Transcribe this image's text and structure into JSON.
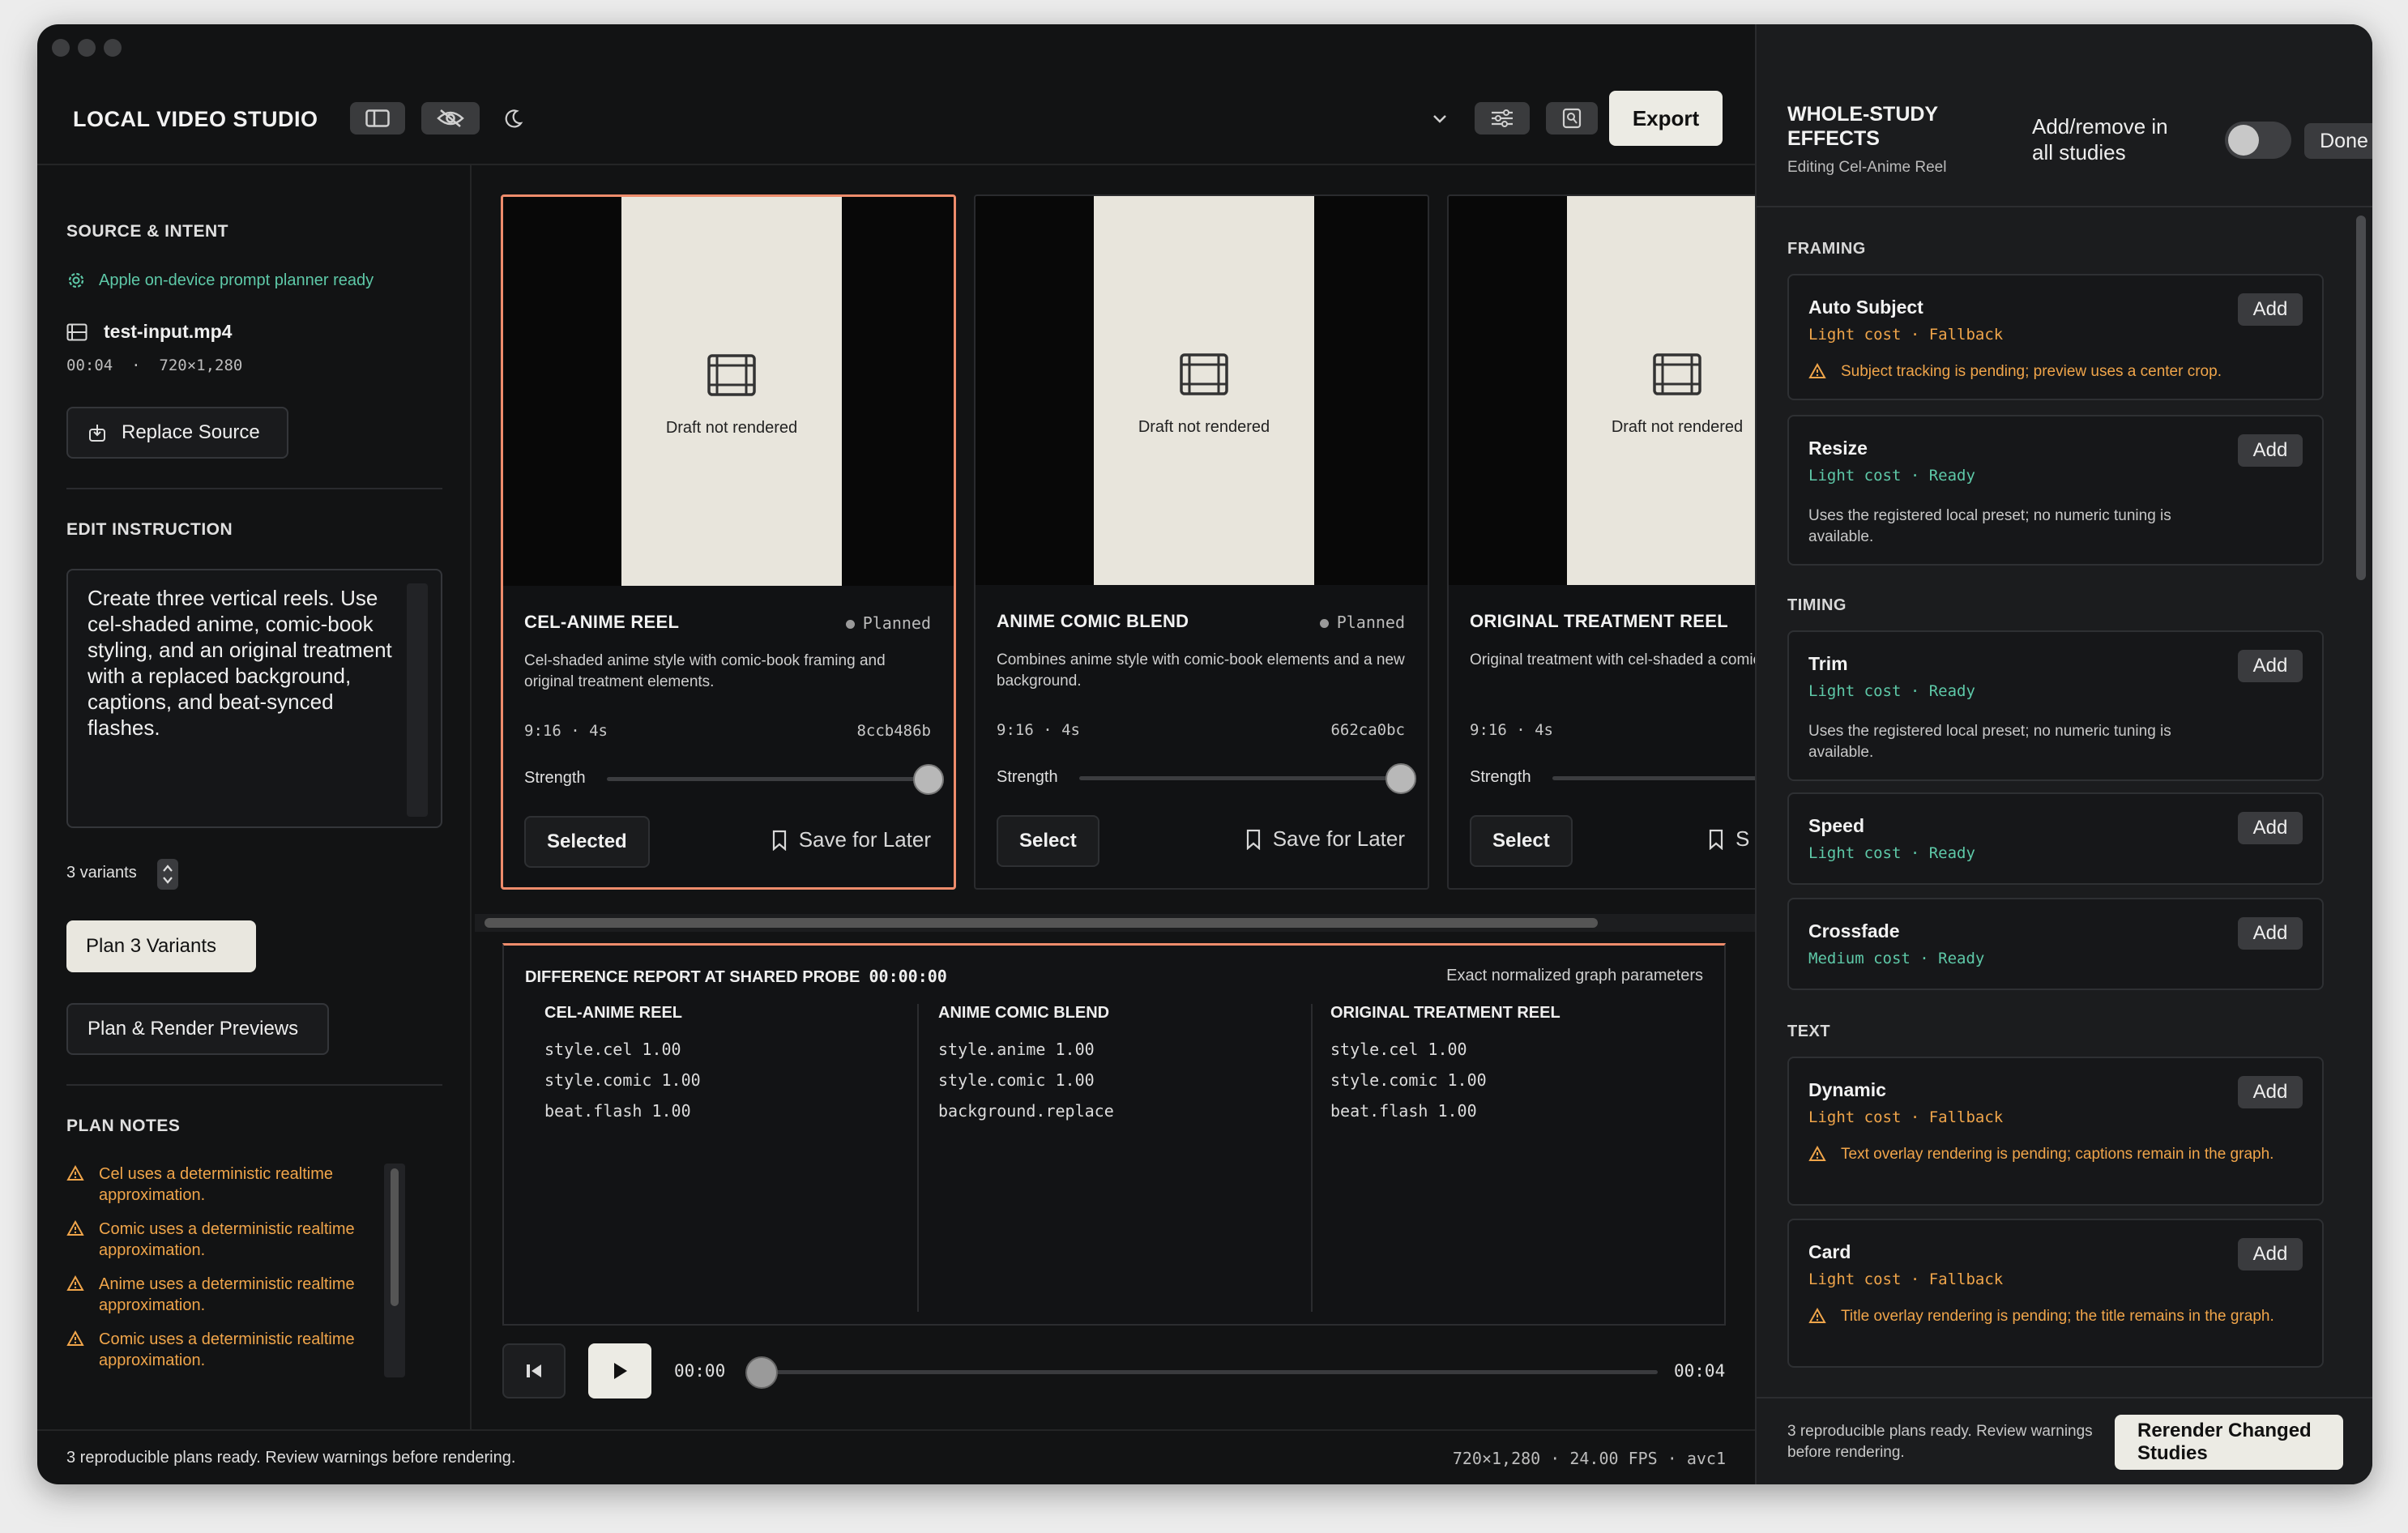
{
  "app": {
    "title": "LOCAL VIDEO STUDIO",
    "export_label": "Export"
  },
  "left": {
    "source_heading": "SOURCE & INTENT",
    "planner_status": "Apple on-device prompt planner ready",
    "file_name": "test-input.mp4",
    "file_meta": "00:04  ·  720×1,280",
    "replace_label": "Replace Source",
    "edit_heading": "EDIT INSTRUCTION",
    "instruction": "Create three vertical reels. Use cel-shaded anime, comic-book styling, and an original treatment with a replaced background, captions, and beat-synced flashes.",
    "variants_label": "3 variants",
    "plan_label": "Plan 3 Variants",
    "plan_render_label": "Plan & Render Previews",
    "notes_heading": "PLAN NOTES",
    "notes": [
      "Cel uses a deterministic realtime approximation.",
      "Comic uses a deterministic realtime approximation.",
      "Anime uses a deterministic realtime approximation.",
      "Comic uses a deterministic realtime approximation."
    ]
  },
  "cards": [
    {
      "title": "CEL-ANIME REEL",
      "status": "Planned",
      "desc": "Cel-shaded anime style with comic-book framing and original treatment elements.",
      "meta": "9:16 · 4s",
      "hash": "8ccb486b",
      "strength_label": "Strength",
      "strength": 1.0,
      "button": "Selected",
      "save": "Save for Later",
      "placeholder": "Draft not rendered"
    },
    {
      "title": "ANIME COMIC BLEND",
      "status": "Planned",
      "desc": "Combines anime style with comic-book elements and a new background.",
      "meta": "9:16 · 4s",
      "hash": "662ca0bc",
      "strength_label": "Strength",
      "strength": 1.0,
      "button": "Select",
      "save": "Save for Later",
      "placeholder": "Draft not rendered"
    },
    {
      "title": "ORIGINAL TREATMENT REEL",
      "status": "",
      "desc": "Original treatment with cel-shaded a comic-book styling.",
      "meta": "9:16 · 4s",
      "hash": "",
      "strength_label": "Strength",
      "strength": 1.0,
      "button": "Select",
      "save": "S",
      "placeholder": "Draft not rendered"
    }
  ],
  "diff": {
    "heading": "DIFFERENCE REPORT AT SHARED PROBE",
    "time": "00:00:00",
    "right_label": "Exact normalized graph parameters",
    "columns": [
      {
        "title": "CEL-ANIME REEL",
        "params": [
          "style.cel  1.00",
          "style.comic  1.00",
          "beat.flash  1.00"
        ]
      },
      {
        "title": "ANIME COMIC BLEND",
        "params": [
          "style.anime  1.00",
          "style.comic  1.00",
          "background.replace"
        ]
      },
      {
        "title": "ORIGINAL TREATMENT REEL",
        "params": [
          "style.cel  1.00",
          "style.comic  1.00",
          "beat.flash  1.00"
        ]
      }
    ]
  },
  "transport": {
    "current": "00:00",
    "total": "00:04",
    "position": 0.0
  },
  "status_bar": {
    "message": "3 reproducible plans ready. Review warnings before rendering.",
    "media": "720×1,280 · 24.00 FPS · avc1"
  },
  "right": {
    "title": "WHOLE-STUDY EFFECTS",
    "subtitle": "Editing Cel-Anime Reel",
    "toggle_label": "Add/remove in all studies",
    "toggle_on": false,
    "done_label": "Done",
    "sections": {
      "framing": "FRAMING",
      "timing": "TIMING",
      "text": "TEXT"
    },
    "effects": {
      "auto_subject": {
        "name": "Auto Subject",
        "cost": "Light cost · Fallback",
        "warning": "Subject tracking is pending; preview uses a center crop.",
        "add": "Add"
      },
      "resize": {
        "name": "Resize",
        "cost": "Light cost · Ready",
        "desc": "Uses the registered local preset; no numeric tuning is available.",
        "add": "Add"
      },
      "trim": {
        "name": "Trim",
        "cost": "Light cost · Ready",
        "desc": "Uses the registered local preset; no numeric tuning is available.",
        "add": "Add"
      },
      "speed": {
        "name": "Speed",
        "cost": "Light cost · Ready",
        "add": "Add"
      },
      "crossfade": {
        "name": "Crossfade",
        "cost": "Medium cost · Ready",
        "add": "Add"
      },
      "dynamic": {
        "name": "Dynamic",
        "cost": "Light cost · Fallback",
        "warning": "Text overlay rendering is pending; captions remain in the graph.",
        "add": "Add"
      },
      "card": {
        "name": "Card",
        "cost": "Light cost · Fallback",
        "warning": "Title overlay rendering is pending; the title remains in the graph.",
        "add": "Add"
      }
    },
    "footer_message": "3 reproducible plans ready. Review warnings before rendering.",
    "rerender_label": "Rerender Changed Studies"
  },
  "colors": {
    "accent": "#ee8c6c",
    "warning": "#f0a54a",
    "ready": "#5ec9a8"
  }
}
